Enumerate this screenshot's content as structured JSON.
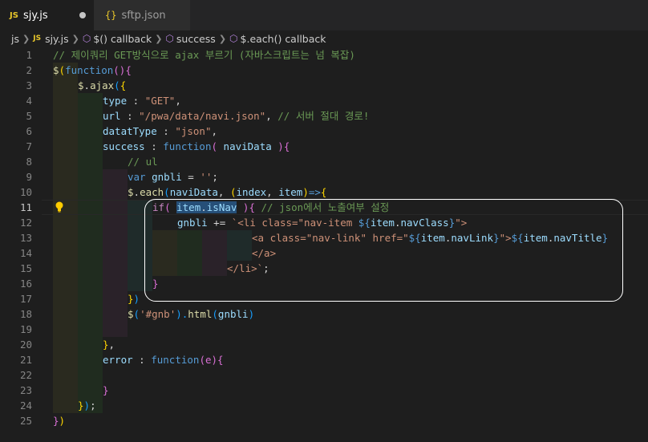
{
  "tabs": [
    {
      "icon": "JS",
      "label": "sjy.js",
      "active": true,
      "dirty": true
    },
    {
      "icon": "{}",
      "label": "sftp.json",
      "active": false
    }
  ],
  "breadcrumbs": [
    "js",
    "sjy.js",
    "$() callback",
    "success",
    "$.each() callback"
  ],
  "breadcrumb_icons": [
    "folder",
    "js-file-icon",
    "method-icon",
    "method-icon",
    "method-icon"
  ],
  "current_line": 11,
  "line_numbers": [
    "1",
    "2",
    "3",
    "4",
    "5",
    "6",
    "7",
    "8",
    "9",
    "10",
    "11",
    "12",
    "13",
    "14",
    "15",
    "16",
    "17",
    "18",
    "19",
    "20",
    "21",
    "22",
    "23",
    "24",
    "25"
  ],
  "code": {
    "l1": "// 제이쿼리 GET방식으로 ajax 부르기 (자바스크립트는 넘 복잡)",
    "l2": [
      "$",
      "(",
      "function",
      "(){"
    ],
    "l3": [
      "$",
      ".",
      "ajax",
      "(",
      "{"
    ],
    "l4": [
      "type",
      " : ",
      "\"GET\"",
      ","
    ],
    "l5": [
      "url",
      " : ",
      "\"/pwa/data/navi.json\"",
      ", ",
      "// 서버 절대 경로!"
    ],
    "l6": [
      "datatType",
      " : ",
      "\"json\"",
      ","
    ],
    "l7": [
      "success",
      " : ",
      "function",
      "( ",
      "naviData",
      " ){"
    ],
    "l8": "// ul",
    "l9": [
      "var",
      " ",
      "gnbli",
      " = ",
      "''",
      ";"
    ],
    "l10": [
      "$",
      ".",
      "each",
      "(",
      "naviData",
      ", ",
      "(",
      "index",
      ", ",
      "item",
      ")",
      "=>",
      "{"
    ],
    "l11": [
      "if",
      "( ",
      "item",
      ".",
      "isNav",
      " )",
      "{",
      " ",
      "// json에서 노출여부 설정"
    ],
    "l12": [
      "gnbli",
      " += ",
      "`<li class=\"nav-item ",
      "${",
      "item",
      ".",
      "navClass",
      "}",
      "\">"
    ],
    "l13": [
      "<a class=\"nav-link\" href=\"",
      "${",
      "item",
      ".",
      "navLink",
      "}",
      "\">",
      "${",
      "item",
      ".",
      "navTitle",
      "}"
    ],
    "l14": "</a>",
    "l15": [
      "</li>`",
      ";"
    ],
    "l16": "}",
    "l17": [
      "}",
      ")"
    ],
    "l18": [
      "$",
      "(",
      "'#gnb'",
      ").",
      "html",
      "(",
      "gnbli",
      ")"
    ],
    "l20": [
      "}",
      ","
    ],
    "l21": [
      "error",
      " : ",
      "function",
      "(e)",
      "{"
    ],
    "l23": "}",
    "l24": [
      "}",
      ")",
      ";"
    ],
    "l25": [
      "}",
      ")"
    ]
  },
  "colors": {
    "background": "#1e1e1e",
    "comment": "#6a9955",
    "keyword": "#569cd6",
    "string": "#ce9178",
    "function": "#dcdcaa",
    "variable": "#9cdcfe",
    "bracket1": "#ffd700",
    "bracket2": "#da70d6",
    "bracket3": "#179fff"
  }
}
